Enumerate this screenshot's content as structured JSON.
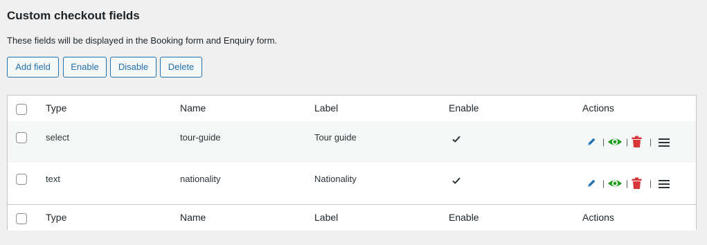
{
  "page": {
    "title": "Custom checkout fields",
    "description": "These fields will be displayed in the Booking form and Enquiry form."
  },
  "toolbar": {
    "add_label": "Add field",
    "enable_label": "Enable",
    "disable_label": "Disable",
    "delete_label": "Delete"
  },
  "table": {
    "columns": [
      "Type",
      "Name",
      "Label",
      "Enable",
      "Actions"
    ],
    "rows": [
      {
        "type": "select",
        "name": "tour-guide",
        "label": "Tour guide",
        "enabled": true
      },
      {
        "type": "text",
        "name": "nationality",
        "label": "Nationality",
        "enabled": true
      }
    ],
    "action_separator": "|"
  },
  "colors": {
    "accent": "#2271b1",
    "view": "#1e9e1e",
    "delete": "#d63638",
    "background": "#f0f0f1"
  },
  "icons": [
    "edit-icon",
    "view-icon",
    "trash-icon",
    "drag-handle-icon",
    "checkmark-icon"
  ]
}
